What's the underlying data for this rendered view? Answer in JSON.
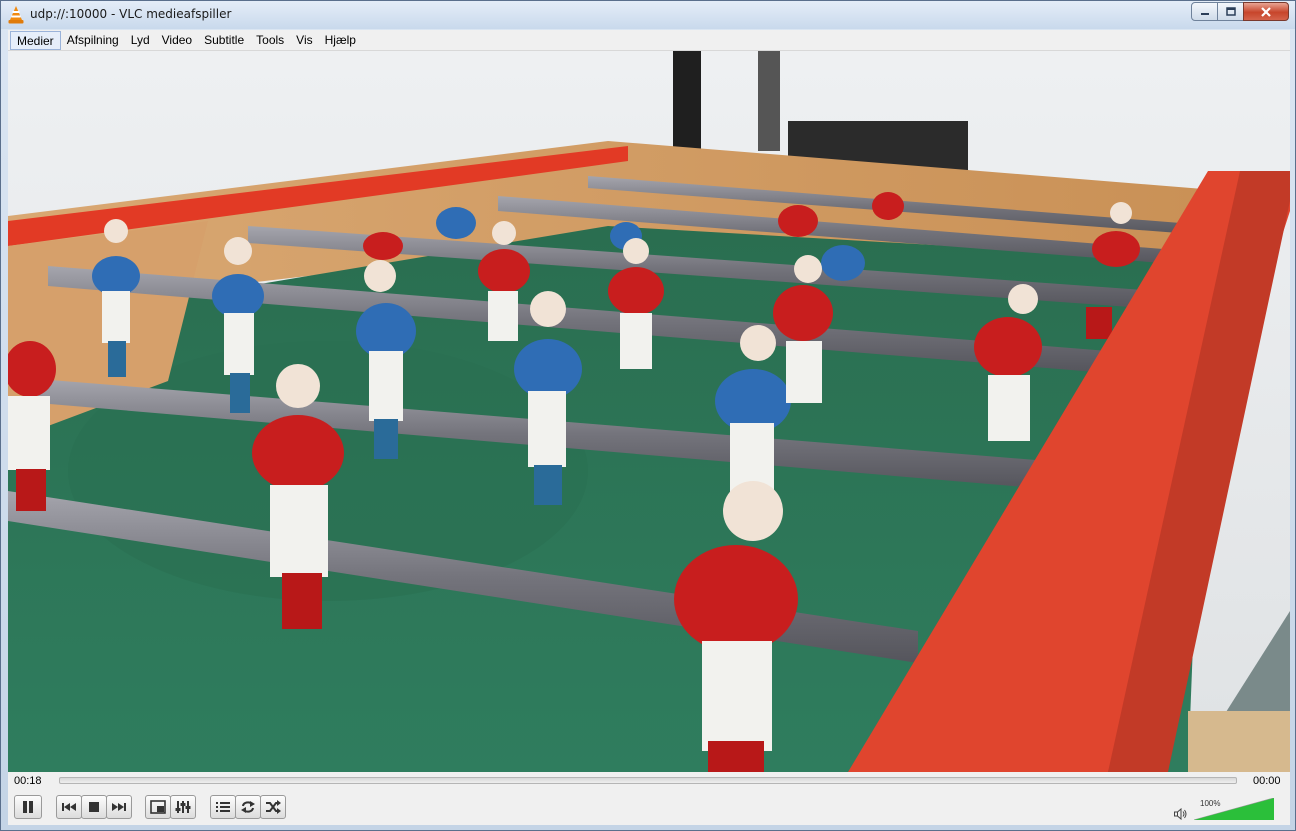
{
  "window": {
    "title": "udp://:10000 - VLC medieafspiller"
  },
  "menu": {
    "items": [
      {
        "label": "Medier",
        "active": true
      },
      {
        "label": "Afspilning",
        "active": false
      },
      {
        "label": "Lyd",
        "active": false
      },
      {
        "label": "Video",
        "active": false
      },
      {
        "label": "Subtitle",
        "active": false
      },
      {
        "label": "Tools",
        "active": false
      },
      {
        "label": "Vis",
        "active": false
      },
      {
        "label": "Hjælp",
        "active": false
      }
    ]
  },
  "player": {
    "elapsed": "00:18",
    "remaining": "00:00",
    "seek_progress": 0,
    "volume_label": "100%",
    "volume_level": 1.0
  },
  "colors": {
    "accent_green": "#2bbf3a",
    "close_red": "#c7452b",
    "table_green": "#2f7a5c",
    "rail_red": "#e0452e",
    "team_red": "#c81e1e",
    "team_blue": "#2f6db5"
  },
  "icons": {
    "app": "vlc-cone-icon",
    "controls": [
      "pause-icon",
      "previous-icon",
      "stop-icon",
      "next-icon",
      "fullscreen-icon",
      "extended-settings-icon",
      "playlist-icon",
      "loop-icon",
      "shuffle-icon",
      "speaker-icon"
    ]
  }
}
